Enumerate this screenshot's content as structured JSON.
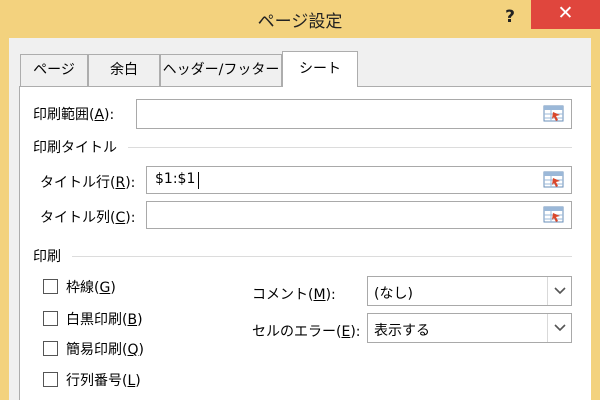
{
  "window": {
    "title": "ページ設定",
    "help_label": "?",
    "close_label": "✕"
  },
  "tabs": [
    {
      "label": "ページ",
      "active": false
    },
    {
      "label": "余白",
      "active": false
    },
    {
      "label": "ヘッダー/フッター",
      "active": false
    },
    {
      "label": "シート",
      "active": true
    }
  ],
  "print_area": {
    "label_prefix": "印刷範囲(",
    "accel": "A",
    "label_suffix": "):",
    "value": ""
  },
  "print_titles": {
    "section_label": "印刷タイトル",
    "rows": {
      "label_prefix": "タイトル行(",
      "accel": "R",
      "label_suffix": "):",
      "value": "$1:$1"
    },
    "columns": {
      "label_prefix": "タイトル列(",
      "accel": "C",
      "label_suffix": "):",
      "value": ""
    }
  },
  "print": {
    "section_label": "印刷",
    "checkboxes": [
      {
        "label_prefix": "枠線(",
        "accel": "G",
        "label_suffix": ")",
        "checked": false
      },
      {
        "label_prefix": "白黒印刷(",
        "accel": "B",
        "label_suffix": ")",
        "checked": false
      },
      {
        "label_prefix": "簡易印刷(",
        "accel": "Q",
        "label_suffix": ")",
        "checked": false
      },
      {
        "label_prefix": "行列番号(",
        "accel": "L",
        "label_suffix": ")",
        "checked": false
      }
    ],
    "comments": {
      "label_prefix": "コメント(",
      "accel": "M",
      "label_suffix": "):",
      "value": "(なし)"
    },
    "cell_errors": {
      "label_prefix": "セルのエラー(",
      "accel": "E",
      "label_suffix": "):",
      "value": "表示する"
    }
  },
  "icons": {
    "range_select": "range-select-icon",
    "dropdown": "chevron-down-icon"
  }
}
